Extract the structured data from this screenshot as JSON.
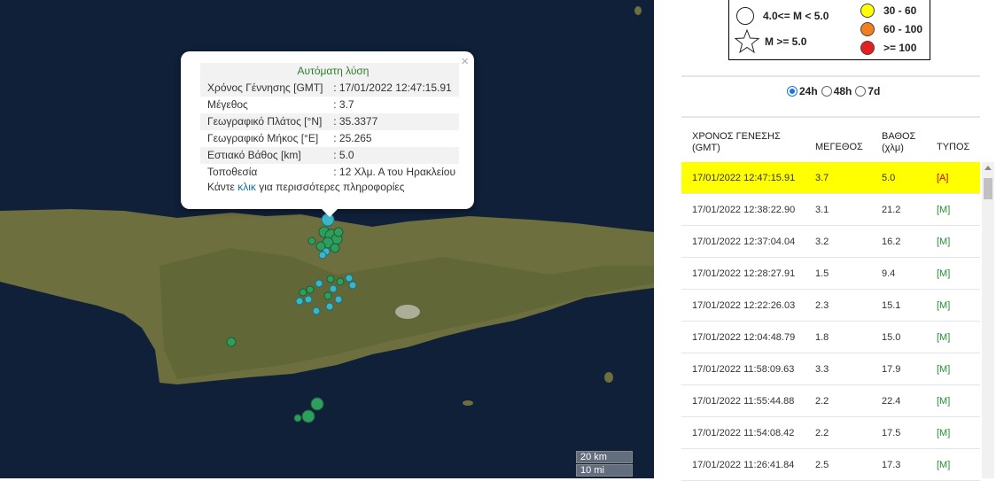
{
  "map": {
    "scale": {
      "km": "20 km",
      "mi": "10 mi"
    },
    "colors": {
      "sea": "#0f2038",
      "land": "#6e6f3e",
      "marker_green": "#2e9e5e",
      "marker_cyan": "#3ab6c7"
    }
  },
  "popup": {
    "close_glyph": "×",
    "title": "Αυτόματη λύση",
    "rows": [
      {
        "label": "Χρόνος Γέννησης [GMT]",
        "value": ": 17/01/2022 12:47:15.91"
      },
      {
        "label": "Μέγεθος",
        "value": ": 3.7"
      },
      {
        "label": "Γεωγραφικό Πλάτος [°N]",
        "value": ": 35.3377"
      },
      {
        "label": "Γεωγραφικό Μήκος [°E]",
        "value": ": 25.265"
      },
      {
        "label": "Εστιακό Βάθος [km]",
        "value": ": 5.0"
      },
      {
        "label": "Τοποθεσία",
        "value": ": 12 Χλμ. Α του Ηρακλείου"
      }
    ],
    "more_prefix": "Κάντε ",
    "more_link": "κλικ",
    "more_suffix": " για περισσότερες πληροφορίες"
  },
  "legend": {
    "items": [
      {
        "label": "4.0<= M < 5.0",
        "icon": "white-circle-icon"
      },
      {
        "label": "M >= 5.0",
        "icon": "star-icon"
      },
      {
        "label": "30 - 60",
        "color": "#ffff00"
      },
      {
        "label": "60 - 100",
        "color": "#f07f1f"
      },
      {
        "label": ">= 100",
        "color": "#e52020"
      }
    ]
  },
  "range": {
    "options": [
      "24h",
      "48h",
      "7d"
    ],
    "selected": "24h"
  },
  "table": {
    "headers": {
      "time": "ΧΡΟΝΟΣ ΓΕΝΕΣΗΣ",
      "time_sub": "(GMT)",
      "mag": "ΜΕΓΕΘΟΣ",
      "depth": "ΒΑΘΟΣ",
      "depth_sub": "(χλμ)",
      "type": "ΤΥΠΟΣ"
    },
    "rows": [
      {
        "time": "17/01/2022 12:47:15.91",
        "mag": "3.7",
        "depth": "5.0",
        "type": "[A]"
      },
      {
        "time": "17/01/2022 12:38:22.90",
        "mag": "3.1",
        "depth": "21.2",
        "type": "[M]"
      },
      {
        "time": "17/01/2022 12:37:04.04",
        "mag": "3.2",
        "depth": "16.2",
        "type": "[M]"
      },
      {
        "time": "17/01/2022 12:28:27.91",
        "mag": "1.5",
        "depth": "9.4",
        "type": "[M]"
      },
      {
        "time": "17/01/2022 12:22:26.03",
        "mag": "2.3",
        "depth": "15.1",
        "type": "[M]"
      },
      {
        "time": "17/01/2022 12:04:48.79",
        "mag": "1.8",
        "depth": "15.0",
        "type": "[M]"
      },
      {
        "time": "17/01/2022 11:58:09.63",
        "mag": "3.3",
        "depth": "17.9",
        "type": "[M]"
      },
      {
        "time": "17/01/2022 11:55:44.88",
        "mag": "2.2",
        "depth": "22.4",
        "type": "[M]"
      },
      {
        "time": "17/01/2022 11:54:08.42",
        "mag": "2.2",
        "depth": "17.5",
        "type": "[M]"
      },
      {
        "time": "17/01/2022 11:26:41.84",
        "mag": "2.5",
        "depth": "17.3",
        "type": "[M]"
      }
    ]
  }
}
